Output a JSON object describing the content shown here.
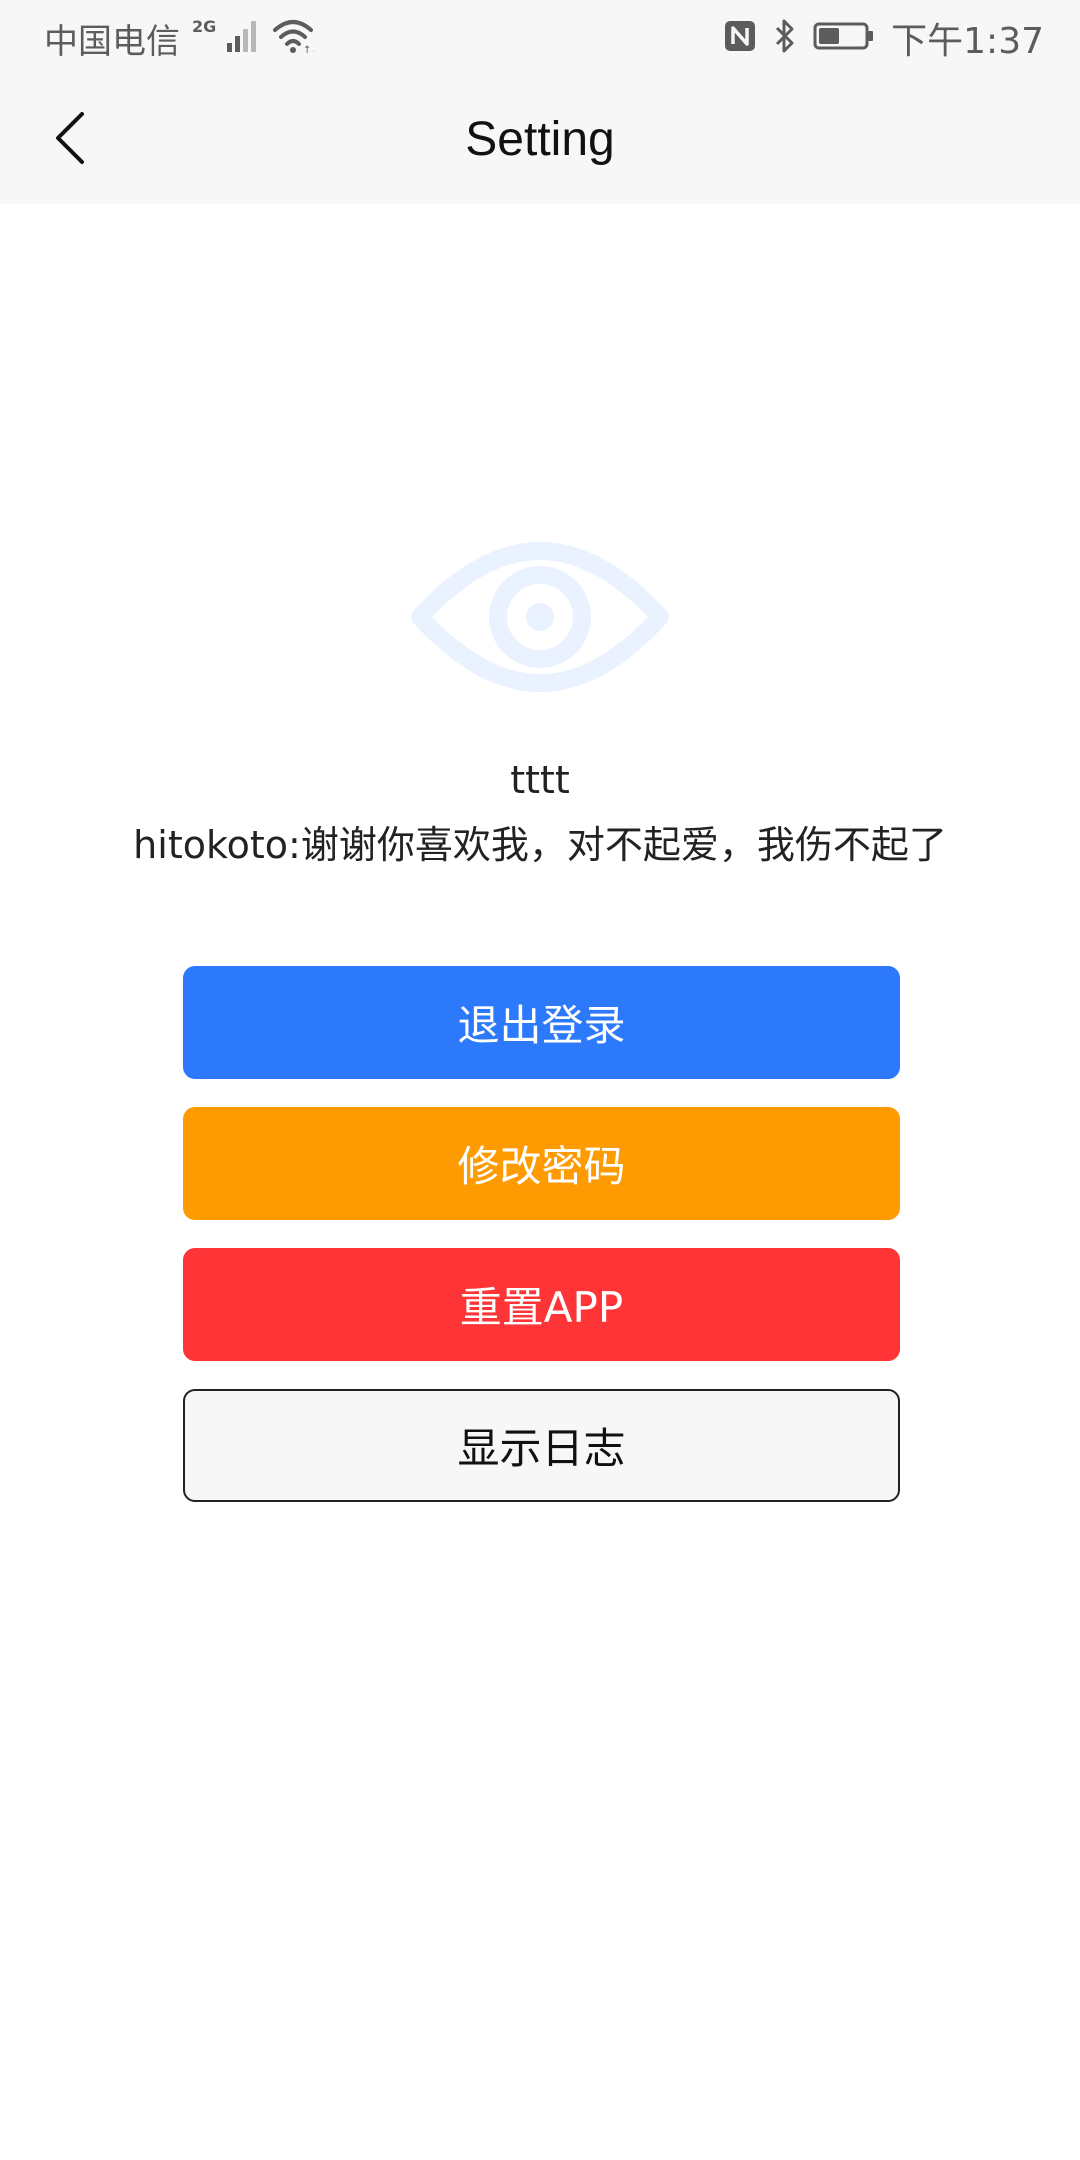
{
  "status_bar": {
    "carrier": "中国电信",
    "network_type": "2G",
    "time": "下午1:37",
    "icons": [
      "signal-icon",
      "wifi-icon",
      "nfc-icon",
      "bluetooth-icon",
      "battery-icon"
    ]
  },
  "nav": {
    "title": "Setting",
    "back_icon": "chevron-left-icon"
  },
  "profile": {
    "logo_icon": "eye-icon",
    "username": "tttt",
    "hitokoto": "hitokoto:谢谢你喜欢我，对不起爱，我伤不起了"
  },
  "buttons": {
    "logout": "退出登录",
    "change_password": "修改密码",
    "reset_app": "重置APP",
    "show_logs": "显示日志"
  },
  "colors": {
    "logout": "#2c79fc",
    "change_password": "#fe9a02",
    "reset_app": "#fe3437",
    "show_logs_bg": "#f7f7f7",
    "eye_logo": "#eaf2ff"
  }
}
